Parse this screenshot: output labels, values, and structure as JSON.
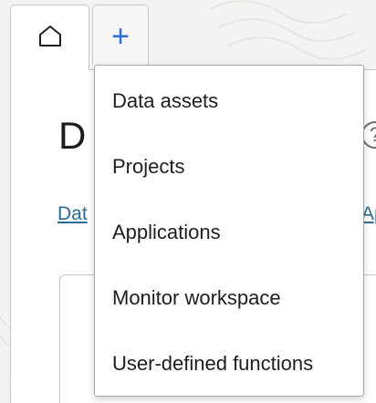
{
  "tabs": {
    "home_icon": "home-icon",
    "add_label": "+",
    "add_icon_color": "#2a6fdb"
  },
  "page": {
    "title": "D",
    "help_glyph": "?",
    "breadcrumb_1": "Dat",
    "breadcrumb_2": "Ap"
  },
  "menu": {
    "items": [
      {
        "label": "Data assets"
      },
      {
        "label": "Projects"
      },
      {
        "label": "Applications"
      },
      {
        "label": "Monitor workspace"
      },
      {
        "label": "User-defined functions"
      }
    ]
  },
  "colors": {
    "link": "#2d6b8f",
    "border": "#c9c7c3"
  }
}
